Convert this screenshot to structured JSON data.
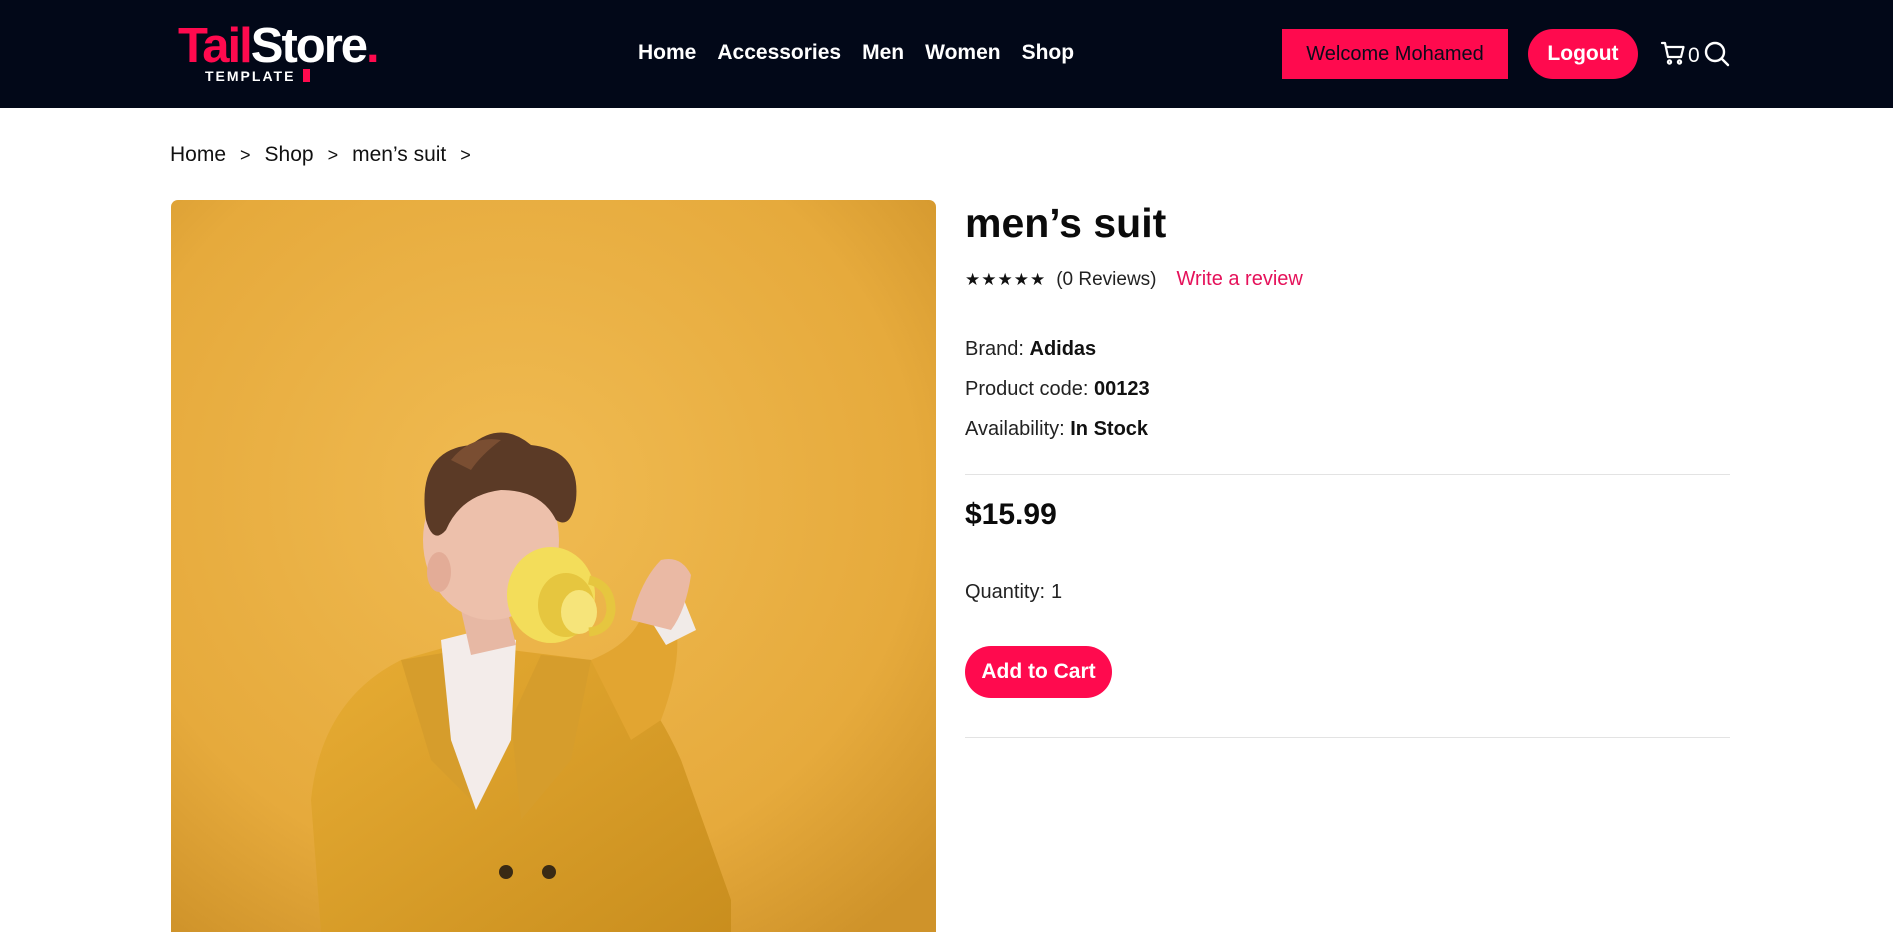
{
  "header": {
    "logo": {
      "main_part1": "Tail",
      "main_part2": "Store",
      "dot": ".",
      "sub": "TEMPLATE"
    },
    "nav": [
      "Home",
      "Accessories",
      "Men",
      "Women",
      "Shop"
    ],
    "welcome_label": "Welcome Mohamed",
    "logout_label": "Logout",
    "cart_count": "0",
    "icons": {
      "cart": "cart-icon",
      "search": "search-icon"
    }
  },
  "breadcrumb": [
    "Home",
    "Shop",
    "men’s suit"
  ],
  "breadcrumb_separator": ">",
  "product": {
    "title": "men’s suit",
    "stars": "★★★★★",
    "reviews_text": "(0 Reviews)",
    "write_review": "Write a review",
    "brand_label": "Brand:",
    "brand_value": "Adidas",
    "code_label": "Product code:",
    "code_value": "00123",
    "availability_label": "Availability:",
    "availability_value": "In Stock",
    "price": "$15.99",
    "quantity_label": "Quantity:",
    "quantity_value": "1",
    "add_to_cart": "Add to Cart",
    "image_alt": "man in yellow suit drinking from a yellow mug"
  },
  "colors": {
    "header_bg": "#020818",
    "accent": "#ff0a4e",
    "link_pink": "#e5115a",
    "image_bg": "#e8ae3e"
  }
}
